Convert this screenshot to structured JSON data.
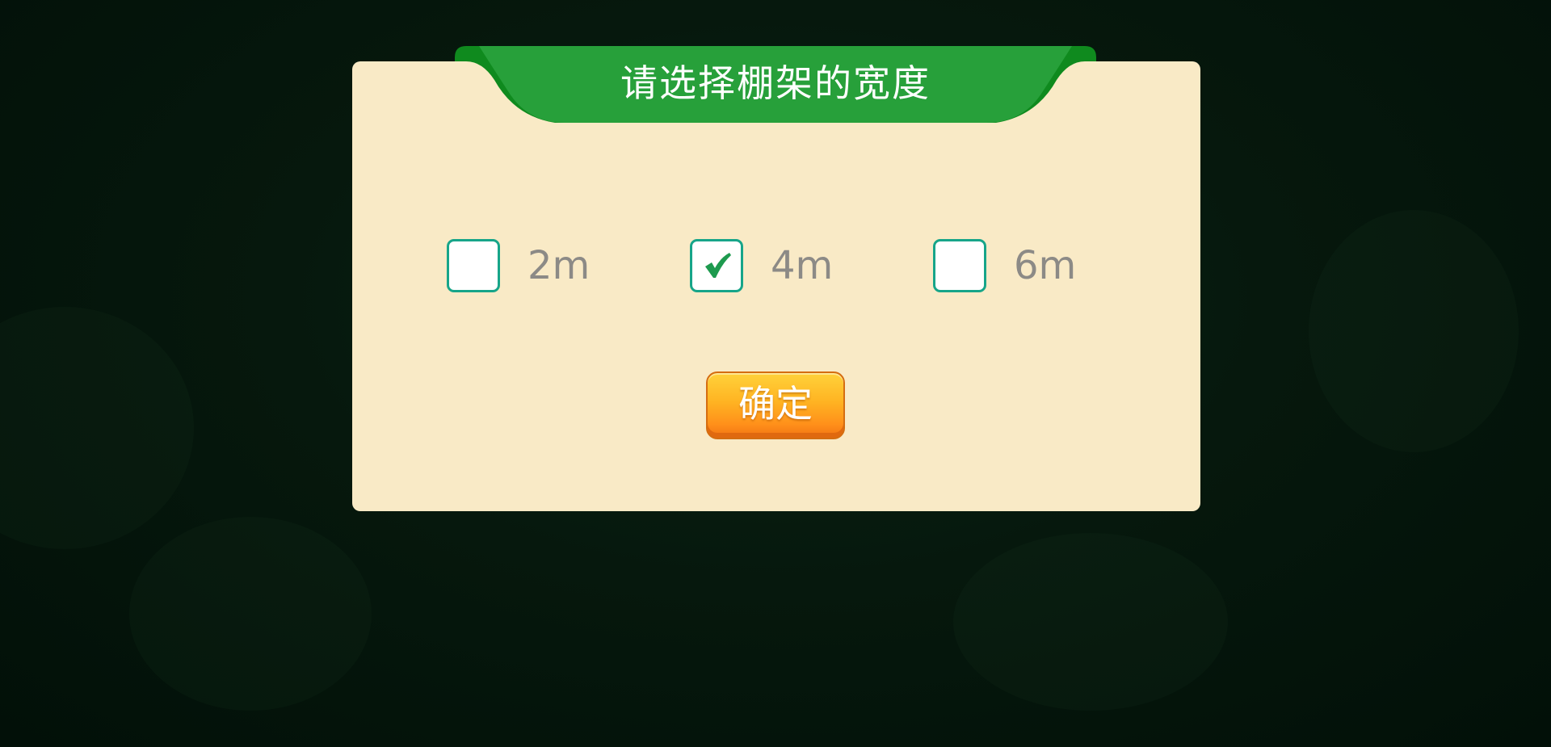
{
  "dialog": {
    "title": "请选择棚架的宽度",
    "options": [
      {
        "label": "2m",
        "checked": false
      },
      {
        "label": "4m",
        "checked": true
      },
      {
        "label": "6m",
        "checked": false
      }
    ],
    "confirm_label": "确定"
  },
  "colors": {
    "panel": "#f9eac6",
    "banner_green": "#27a03a",
    "checkbox_border": "#17a589",
    "check_mark": "#1d9a4e",
    "button_orange": "#ff9a1c"
  },
  "icons": {
    "check": "check-icon"
  }
}
